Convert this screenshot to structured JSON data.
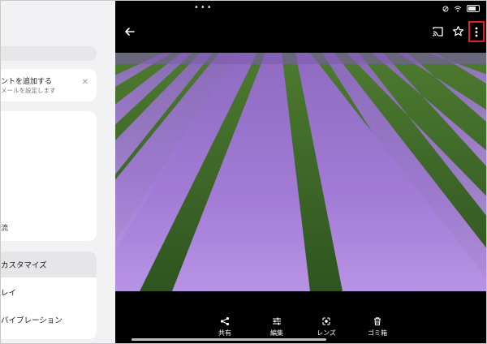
{
  "settings_panel": {
    "account_card": {
      "title": "ントを追加する",
      "subtitle": "メールを設定します"
    },
    "big_card_item": "流",
    "menu": [
      {
        "label": "カスタマイズ",
        "selected": true
      },
      {
        "label": "レイ",
        "selected": false
      },
      {
        "label": "バイブレーション",
        "selected": false
      }
    ]
  },
  "viewer": {
    "status_dots": "•••",
    "actions": [
      {
        "label": "共有",
        "icon": "share-icon"
      },
      {
        "label": "編集",
        "icon": "edit-sliders-icon"
      },
      {
        "label": "レンズ",
        "icon": "lens-icon"
      },
      {
        "label": "ゴミ箱",
        "icon": "trash-icon"
      }
    ],
    "colors": {
      "highlight": "#e02020",
      "lavender": "#9b6fd0",
      "foliage": "#3f6e2c"
    }
  }
}
